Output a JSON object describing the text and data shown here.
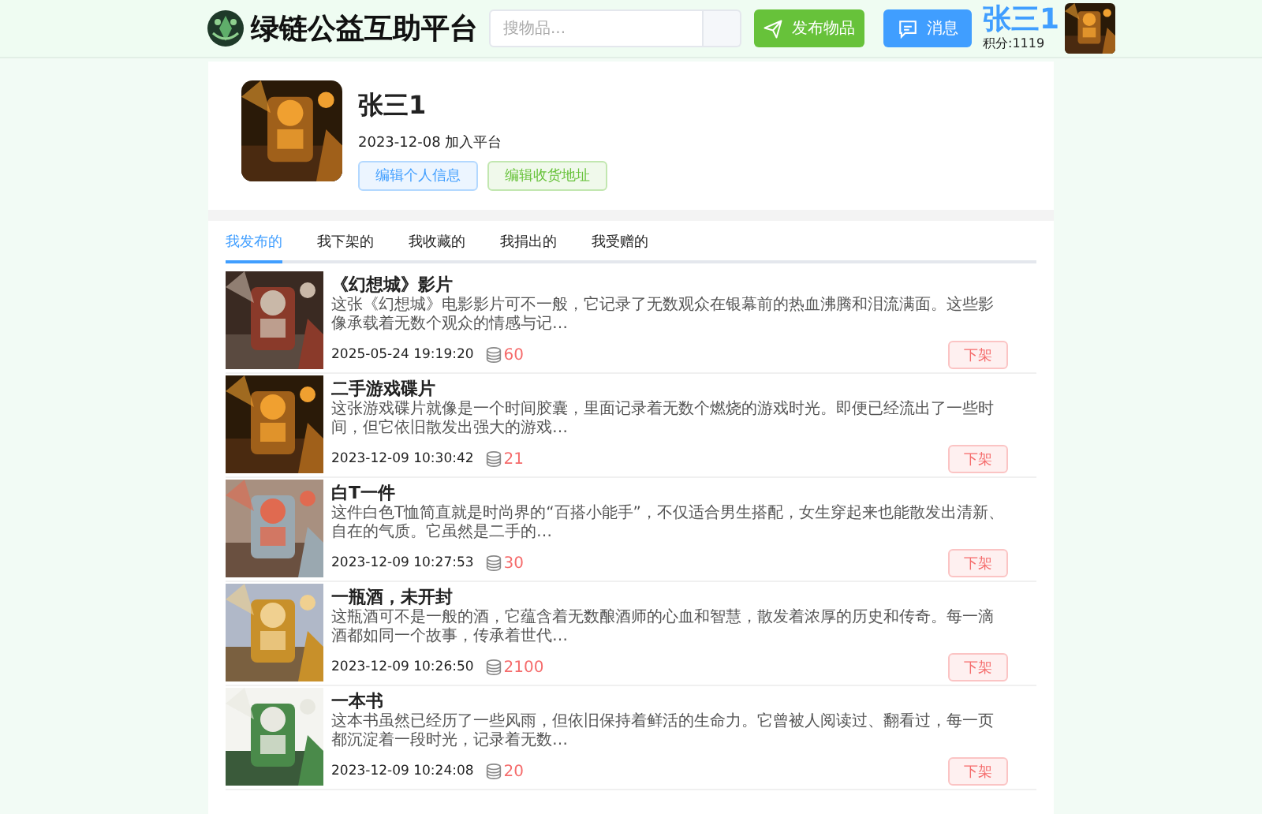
{
  "header": {
    "title": "绿链公益互助平台",
    "search": {
      "placeholder": "搜物品..."
    },
    "publish_button": "发布物品",
    "message_button": "消息",
    "user": {
      "name": "张三1",
      "points": "积分:1119"
    }
  },
  "profile": {
    "name": "张三1",
    "joined": "2023-12-08 加入平台",
    "buttons": [
      {
        "label": "编辑个人信息",
        "kind": "primary"
      },
      {
        "label": "编辑收货地址",
        "kind": "success"
      }
    ]
  },
  "tabs": [
    {
      "label": "我发布的",
      "selected": true
    },
    {
      "label": "我下架的",
      "selected": false
    },
    {
      "label": "我收藏的",
      "selected": false
    },
    {
      "label": "我捐出的",
      "selected": false
    },
    {
      "label": "我受赠的",
      "selected": false
    }
  ],
  "items": [
    {
      "title": "《幻想城》影片",
      "description": "这张《幻想城》电影影片可不一般，它记录了无数观众在银幕前的热血沸腾和泪流满面。这些影像承载着无数个观众的情感与记…",
      "time": "2025-05-24 19:19:20",
      "price": "60",
      "action": "下架"
    },
    {
      "title": "二手游戏碟片",
      "description": "这张游戏碟片就像是一个时间胶囊，里面记录着无数个燃烧的游戏时光。即便已经流出了一些时间，但它依旧散发出强大的游戏…",
      "time": "2023-12-09 10:30:42",
      "price": "21",
      "action": "下架"
    },
    {
      "title": "白T一件",
      "description": "这件白色T恤简直就是时尚界的“百搭小能手”，不仅适合男生搭配，女生穿起来也能散发出清新、自在的气质。它虽然是二手的…",
      "time": "2023-12-09 10:27:53",
      "price": "30",
      "action": "下架"
    },
    {
      "title": "一瓶酒，未开封",
      "description": "这瓶酒可不是一般的酒，它蕴含着无数酿酒师的心血和智慧，散发着浓厚的历史和传奇。每一滴酒都如同一个故事，传承着世代…",
      "time": "2023-12-09 10:26:50",
      "price": "2100",
      "action": "下架"
    },
    {
      "title": "一本书",
      "description": "这本书虽然已经历了一些风雨，但依旧保持着鲜活的生命力。它曾被人阅读过、翻看过，每一页都沉淀着一段时光，记录着无数…",
      "time": "2023-12-09 10:24:08",
      "price": "20",
      "action": "下架"
    }
  ]
}
